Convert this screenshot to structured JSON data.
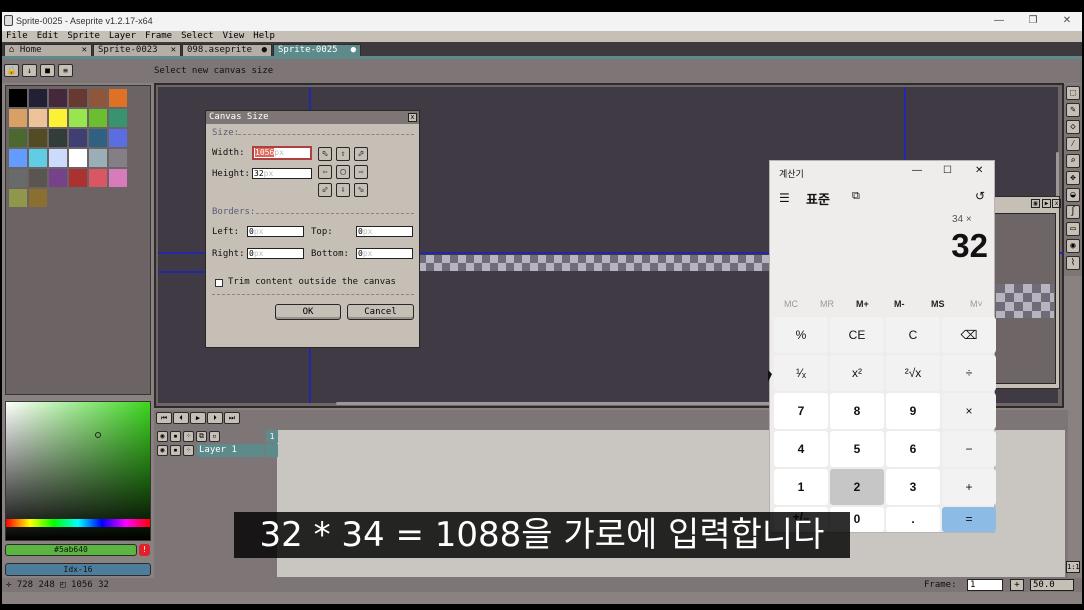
{
  "window": {
    "title": "Sprite-0025 - Aseprite v1.2.17-x64",
    "minimize": "—",
    "maximize": "❐",
    "close": "✕"
  },
  "menu": [
    "File",
    "Edit",
    "Sprite",
    "Layer",
    "Frame",
    "Select",
    "View",
    "Help"
  ],
  "tabs": [
    {
      "label": "⌂ Home",
      "close": "✕"
    },
    {
      "label": "Sprite-0023",
      "close": "✕"
    },
    {
      "label": "098.aseprite",
      "close": "●"
    },
    {
      "label": "Sprite-0025",
      "close": "●"
    }
  ],
  "toolbar": {
    "status": "Select new canvas size",
    "buttons": [
      "🔒",
      "↓",
      "■",
      "≡"
    ]
  },
  "palette": {
    "colors": [
      "#000000",
      "#222034",
      "#45283c",
      "#663931",
      "#8f563b",
      "#df7126",
      "#d9a066",
      "#eec39a",
      "#fbf236",
      "#99e550",
      "#6abe30",
      "#37946e",
      "#4b692f",
      "#524b24",
      "#323c39",
      "#3f3f74",
      "#306082",
      "#5b6ee1",
      "#639bff",
      "#5fcde4",
      "#cbdbfc",
      "#ffffff",
      "#9badb7",
      "#847e87",
      "#696a6a",
      "#595652",
      "#76428a",
      "#ac3232",
      "#d95763",
      "#d77bba",
      "#8f974a",
      "#8a6f30"
    ]
  },
  "color_picker": {
    "hex": "#5ab640",
    "index": "Idx-16",
    "warn": "!"
  },
  "status": {
    "coords": "✛ 728 248  ◰ 1056 32",
    "frame_label": "Frame:",
    "frame_value": "1",
    "add": "+",
    "zoom": "50.0",
    "ratio": "1:1"
  },
  "timeline": {
    "layer_name": "Layer 1",
    "frame_number": "1",
    "buttons": [
      "⏮",
      "⏴",
      "▶",
      "⏵",
      "⏭"
    ]
  },
  "dialog": {
    "title": "Canvas Size",
    "close": "x",
    "size_section": "Size:",
    "width_label": "Width:",
    "width_value": "1056",
    "height_label": "Height:",
    "height_value": "32",
    "unit": "px",
    "borders_section": "Borders:",
    "left_label": "Left:",
    "left_value": "0",
    "top_label": "Top:",
    "top_value": "0",
    "right_label": "Right:",
    "right_value": "0",
    "bottom_label": "Bottom:",
    "bottom_value": "0",
    "trim_label": "Trim content outside the canvas",
    "ok": "OK",
    "cancel": "Cancel",
    "anchors": [
      "⬁",
      "⇧",
      "⬀",
      "⇦",
      "▢",
      "⇨",
      "⬃",
      "⇩",
      "⬂"
    ]
  },
  "calculator": {
    "title": "계산기",
    "mode": "표준",
    "expression": "34 ×",
    "display": "32",
    "memory": [
      "MC",
      "MR",
      "M+",
      "M-",
      "MS",
      "M˅"
    ],
    "keys": [
      [
        "%",
        "CE",
        "C",
        "⌫"
      ],
      [
        "¹⁄ₓ",
        "x²",
        "²√x",
        "÷"
      ],
      [
        "7",
        "8",
        "9",
        "×"
      ],
      [
        "4",
        "5",
        "6",
        "−"
      ],
      [
        "1",
        "2",
        "3",
        "+"
      ],
      [
        "+/₋",
        "0",
        ".",
        "="
      ]
    ]
  },
  "subtitle": "32 * 34 = 1088을 가로에 입력합니다"
}
